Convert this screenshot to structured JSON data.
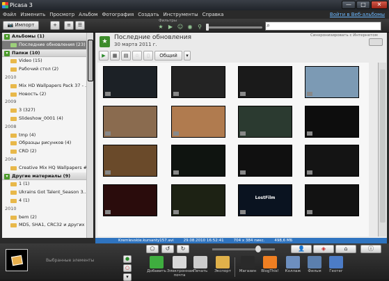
{
  "window": {
    "title": "Picasa 3",
    "controls": [
      "—",
      "□",
      "✕"
    ]
  },
  "menu": [
    "Файл",
    "Изменить",
    "Просмотр",
    "Альбом",
    "Фотография",
    "Создать",
    "Инструменты",
    "Справка"
  ],
  "signin_link": "Войти в Веб-альбомы",
  "toolbar": {
    "import_label": "Импорт",
    "filters_label": "Фильтры",
    "filter_icons": [
      "star-icon",
      "video-icon",
      "person-icon",
      "location-icon",
      "pin-icon"
    ]
  },
  "sidebar": {
    "albums": {
      "label": "Альбомы (1)",
      "items": [
        {
          "label": "Последние обновления (23)",
          "selected": true
        }
      ]
    },
    "folders": {
      "label": "Папки (10)",
      "groups": [
        {
          "year": "",
          "items": [
            "Video (15)",
            "Рабочий стол (2)"
          ]
        },
        {
          "year": "2010",
          "items": [
            "Mix HD Wallpapers Pack 37 - ...",
            "Новость (2)"
          ]
        },
        {
          "year": "2009",
          "items": [
            "3 (327)",
            "Slideshow_0001 (4)"
          ]
        },
        {
          "year": "2008",
          "items": [
            "tmp (4)",
            "Образцы рисунков (4)",
            "CRD (2)"
          ]
        },
        {
          "year": "2004",
          "items": [
            "Creative Mix HQ Wallpapers #..."
          ]
        }
      ]
    },
    "other": {
      "label": "Другие материалы (9)",
      "groups": [
        {
          "year": "",
          "items": [
            "1 (1)",
            "Ukrains Got Talent_Season 3...",
            "4 (1)"
          ]
        },
        {
          "year": "2010",
          "items": [
            "bem (2)",
            "MD5, SHA1, CRC32 и других ..."
          ]
        }
      ]
    }
  },
  "content": {
    "title": "Последние обновления",
    "date": "30 марта 2011 г.",
    "sync_label": "Синхронизировать с Интернетом",
    "share_label": "Общий доступ",
    "thumbnails": [
      {
        "bg": "#1c2126",
        "label": ""
      },
      {
        "bg": "#232323",
        "label": ""
      },
      {
        "bg": "#1a1a1a",
        "label": ""
      },
      {
        "bg": "#7c9ab4",
        "label": ""
      },
      {
        "bg": "#8a6b4f",
        "label": ""
      },
      {
        "bg": "#b07b4f",
        "label": ""
      },
      {
        "bg": "#2b3a30",
        "label": ""
      },
      {
        "bg": "#0d0d0d",
        "label": ""
      },
      {
        "bg": "#6a4a2a",
        "label": ""
      },
      {
        "bg": "#0f1410",
        "label": ""
      },
      {
        "bg": "#101010",
        "label": ""
      },
      {
        "bg": "#141414",
        "label": ""
      },
      {
        "bg": "#2a0c0c",
        "label": ""
      },
      {
        "bg": "#1d2214",
        "label": ""
      },
      {
        "bg": "#0a1320",
        "label": "LostFilm"
      },
      {
        "bg": "#121212",
        "label": ""
      }
    ]
  },
  "status": {
    "file": "Kremlevskie.kursanty157.avi",
    "datetime": "29.08.2010 16:52:41",
    "size_px": "704 x 384 пикс.",
    "size_mb": "498,6 МБ"
  },
  "tray": {
    "label": "Выбранные элементы",
    "actions": [
      {
        "label": "Добавить",
        "color": "#3fae3f"
      },
      {
        "label": "Электронная почта",
        "color": "#d9d9d9"
      },
      {
        "label": "Печать",
        "color": "#cccccc"
      },
      {
        "label": "Экспорт",
        "color": "#e0b14a"
      },
      {
        "label": "Магазин",
        "color": "#2a2a2a"
      },
      {
        "label": "BlogThis!",
        "color": "#ef7f22"
      },
      {
        "label": "Коллаж",
        "color": "#6d8fbf"
      },
      {
        "label": "Фильм",
        "color": "#5b7fae"
      },
      {
        "label": "Геотег",
        "color": "#4c7cc7"
      }
    ]
  }
}
